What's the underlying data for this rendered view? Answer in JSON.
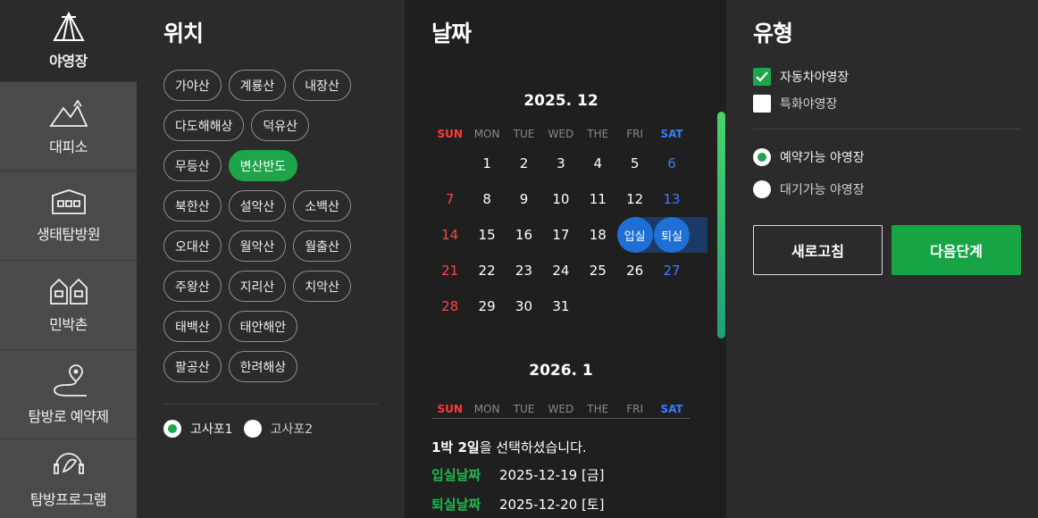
{
  "nav": {
    "items": [
      {
        "label": "야영장",
        "icon": "tent-icon"
      },
      {
        "label": "대피소",
        "icon": "mountain-shelter-icon"
      },
      {
        "label": "생태탐방원",
        "icon": "building-icon"
      },
      {
        "label": "민박촌",
        "icon": "houses-icon"
      },
      {
        "label": "탐방로 예약제",
        "icon": "trail-pin-icon"
      },
      {
        "label": "탐방프로그램",
        "icon": "program-headset-icon"
      }
    ]
  },
  "location": {
    "title": "위치",
    "chips": [
      "가야산",
      "계룡산",
      "내장산",
      "다도해해상",
      "덕유산",
      "무등산",
      "변산반도",
      "북한산",
      "설악산",
      "소백산",
      "오대산",
      "월악산",
      "월출산",
      "주왕산",
      "지리산",
      "치악산",
      "태백산",
      "태안해안",
      "팔공산",
      "한려해상"
    ],
    "selected": "변산반도",
    "sites": [
      "고사포1",
      "고사포2"
    ],
    "site_selected": "고사포1"
  },
  "date": {
    "title": "날짜",
    "dow": [
      "SUN",
      "MON",
      "TUE",
      "WED",
      "THE",
      "FRI",
      "SAT"
    ],
    "month1": {
      "title": "2025. 12",
      "weeks": [
        [
          "",
          "1",
          "2",
          "3",
          "4",
          "5",
          "6"
        ],
        [
          "7",
          "8",
          "9",
          "10",
          "11",
          "12",
          "13"
        ],
        [
          "14",
          "15",
          "16",
          "17",
          "18",
          "입실",
          "퇴실"
        ],
        [
          "21",
          "22",
          "23",
          "24",
          "25",
          "26",
          "27"
        ],
        [
          "28",
          "29",
          "30",
          "31",
          "",
          "",
          ""
        ]
      ]
    },
    "month2": {
      "title": "2026. 1"
    },
    "summary_bold": "1박 2일",
    "summary_rest": "을 선택하셨습니다.",
    "checkin_label": "입실날짜",
    "checkin_value": "2025-12-19 [금]",
    "checkout_label": "퇴실날짜",
    "checkout_value": "2025-12-20 [토]"
  },
  "type": {
    "title": "유형",
    "checks": [
      {
        "label": "자동차야영장",
        "checked": true
      },
      {
        "label": "특화야영장",
        "checked": false
      }
    ],
    "radios": [
      {
        "label": "예약가능 야영장",
        "checked": true
      },
      {
        "label": "대기가능 야영장",
        "checked": false
      }
    ],
    "reset_label": "새로고침",
    "next_label": "다음단계"
  },
  "colors": {
    "accent": "#1ea44a",
    "selected_day": "#1f6fd6",
    "sunday": "#ff4444",
    "saturday": "#3b7bff"
  }
}
